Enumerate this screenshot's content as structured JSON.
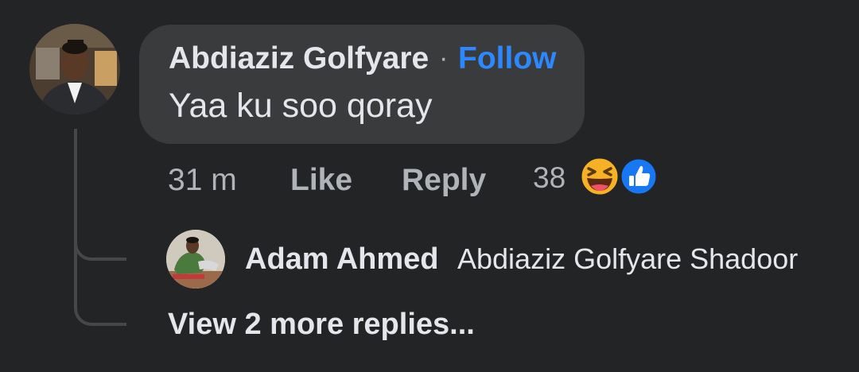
{
  "comment": {
    "author": "Abdiaziz Golfyare",
    "separator": "·",
    "follow_label": "Follow",
    "text": "Yaa ku soo qoray",
    "timestamp": "31 m",
    "like_label": "Like",
    "reply_label": "Reply",
    "reaction_count": "38",
    "reaction_icons": [
      "laughing-emoji-icon",
      "thumbs-up-icon"
    ]
  },
  "reply": {
    "author": "Adam Ahmed",
    "text": "Abdiaziz Golfyare Shadoor"
  },
  "view_more_label": "View 2 more replies...",
  "colors": {
    "background": "#232426",
    "bubble": "#3a3b3d",
    "link_blue": "#2d88ff",
    "primary_text": "#e4e6eb",
    "secondary_text": "#b0b3b8",
    "thread_line": "#45474a"
  }
}
